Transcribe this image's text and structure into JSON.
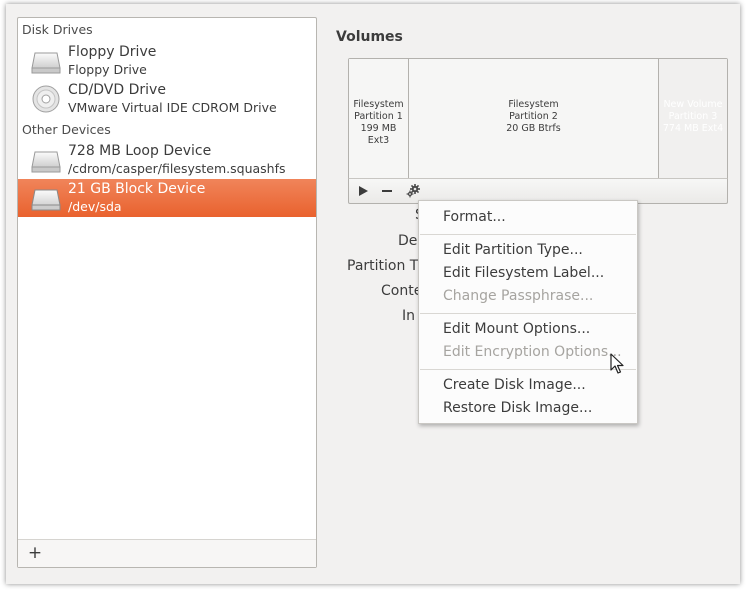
{
  "sidebar": {
    "disk_drives_header": "Disk Drives",
    "other_devices_header": "Other Devices",
    "devices": [
      {
        "name": "Floppy Drive",
        "sub": "Floppy Drive",
        "icon": "drive-icon"
      },
      {
        "name": "CD/DVD Drive",
        "sub": "VMware Virtual IDE CDROM Drive",
        "icon": "optical-disc-icon"
      },
      {
        "name": "728 MB Loop Device",
        "sub": "/cdrom/casper/filesystem.squashfs",
        "icon": "drive-icon"
      },
      {
        "name": "21 GB Block Device",
        "sub": "/dev/sda",
        "icon": "drive-icon",
        "selected": true
      }
    ],
    "add_label": "+"
  },
  "volumes": {
    "title": "Volumes",
    "partitions": [
      {
        "line1": "Filesystem",
        "line2": "Partition 1",
        "line3": "199 MB Ext3"
      },
      {
        "line1": "Filesystem",
        "line2": "Partition 2",
        "line3": "20 GB Btrfs"
      },
      {
        "line1": "New Volume",
        "line2": "Partition 3",
        "line3": "774 MB Ext4"
      }
    ],
    "toolbar_icons": [
      "play-icon",
      "minus-icon",
      "gear-icon"
    ]
  },
  "properties": {
    "size_label": "S",
    "device_label": "De",
    "partition_type_label": "Partition T",
    "contents_label": "Conte",
    "in_label": "In"
  },
  "menu": {
    "items": [
      {
        "label": "Format...",
        "enabled": true
      },
      {
        "label": "Edit Partition Type...",
        "enabled": true
      },
      {
        "label": "Edit Filesystem Label...",
        "enabled": true
      },
      {
        "label": "Change Passphrase...",
        "enabled": false
      },
      {
        "label": "Edit Mount Options...",
        "enabled": true
      },
      {
        "label": "Edit Encryption Options...",
        "enabled": false
      },
      {
        "label": "Create Disk Image...",
        "enabled": true
      },
      {
        "label": "Restore Disk Image...",
        "enabled": true
      }
    ]
  },
  "colors": {
    "selection": "#e9622e",
    "window_bg": "#f2f1f0",
    "disabled_text": "#a6a4a0"
  }
}
